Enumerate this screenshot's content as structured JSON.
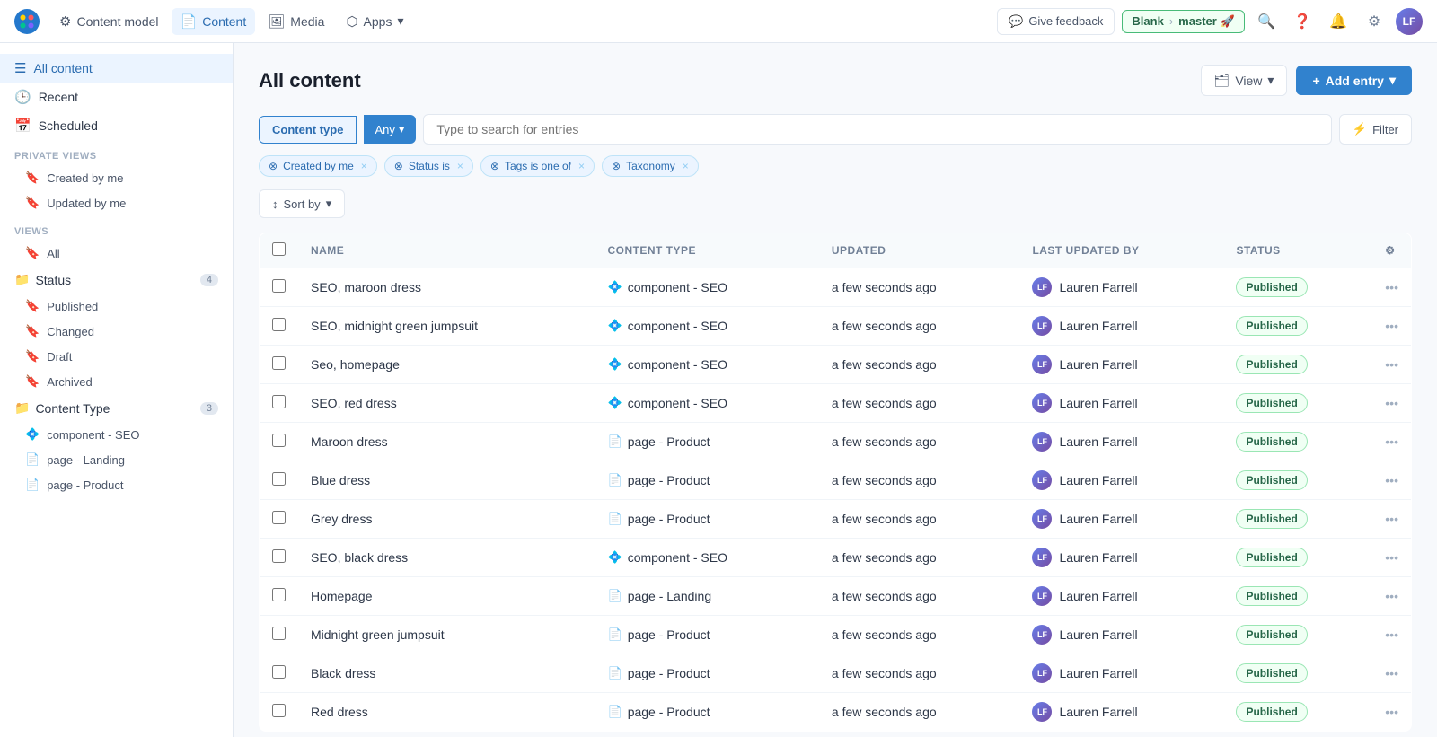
{
  "app": {
    "logo_alt": "Contentful Logo"
  },
  "topnav": {
    "items": [
      {
        "id": "content-model",
        "label": "Content model",
        "icon": "⚙",
        "active": false
      },
      {
        "id": "content",
        "label": "Content",
        "icon": "📄",
        "active": true
      },
      {
        "id": "media",
        "label": "Media",
        "icon": "🖼",
        "active": false
      },
      {
        "id": "apps",
        "label": "Apps",
        "icon": "⬡",
        "active": false,
        "has_arrow": true
      }
    ],
    "feedback": {
      "label": "Give feedback",
      "icon": "💬"
    },
    "env_badge": {
      "space": "Blank",
      "branch": "master",
      "branch_icon": "🚀"
    },
    "icon_btns": [
      "search",
      "help",
      "notifications",
      "settings"
    ],
    "avatar": {
      "initials": "LF"
    }
  },
  "sidebar": {
    "top_items": [
      {
        "id": "all-content",
        "label": "All content",
        "icon": "☰",
        "active": true
      },
      {
        "id": "recent",
        "label": "Recent",
        "icon": "🕒",
        "active": false
      },
      {
        "id": "scheduled",
        "label": "Scheduled",
        "icon": "📅",
        "active": false
      }
    ],
    "private_views_label": "Private views",
    "private_views": [
      {
        "id": "created-by-me",
        "label": "Created by me",
        "icon": "🔖"
      },
      {
        "id": "updated-by-me",
        "label": "Updated by me",
        "icon": "🔖"
      }
    ],
    "views_label": "Views",
    "views_all": {
      "id": "all",
      "label": "All",
      "icon": "🔖"
    },
    "status_group": {
      "label": "Status",
      "count": 4,
      "items": [
        {
          "id": "published",
          "label": "Published",
          "icon": "🔖"
        },
        {
          "id": "changed",
          "label": "Changed",
          "icon": "🔖"
        },
        {
          "id": "draft",
          "label": "Draft",
          "icon": "🔖"
        },
        {
          "id": "archived",
          "label": "Archived",
          "icon": "🔖"
        }
      ]
    },
    "content_type_group": {
      "label": "Content Type",
      "count": 3,
      "items": [
        {
          "id": "component-seo",
          "label": "component - SEO",
          "icon_type": "blue"
        },
        {
          "id": "page-landing",
          "label": "page - Landing",
          "icon_type": "gray"
        },
        {
          "id": "page-product",
          "label": "page - Product",
          "icon_type": "gray"
        }
      ]
    }
  },
  "main": {
    "page_title": "All content",
    "view_btn_label": "View",
    "add_entry_btn_label": "Add entry",
    "filters": {
      "content_type_btn": "Content type",
      "any_btn": "Any",
      "search_placeholder": "Type to search for entries",
      "filter_btn_label": "Filter",
      "active_tags": [
        {
          "id": "created-by-me",
          "label": "Created by me"
        },
        {
          "id": "status-is",
          "label": "Status is"
        },
        {
          "id": "tags-is-one-of",
          "label": "Tags is one of"
        },
        {
          "id": "taxonomy",
          "label": "Taxonomy"
        }
      ]
    },
    "sort": {
      "label": "Sort by"
    },
    "table": {
      "headers": [
        "Name",
        "Content Type",
        "Updated",
        "Last updated by",
        "Status"
      ],
      "rows": [
        {
          "id": 1,
          "name": "SEO, maroon dress",
          "content_type": "component - SEO",
          "ct_icon": "blue",
          "updated": "a few seconds ago",
          "updated_by": "Lauren Farrell",
          "status": "Published"
        },
        {
          "id": 2,
          "name": "SEO, midnight green jumpsuit",
          "content_type": "component - SEO",
          "ct_icon": "blue",
          "updated": "a few seconds ago",
          "updated_by": "Lauren Farrell",
          "status": "Published"
        },
        {
          "id": 3,
          "name": "Seo, homepage",
          "content_type": "component - SEO",
          "ct_icon": "blue",
          "updated": "a few seconds ago",
          "updated_by": "Lauren Farrell",
          "status": "Published"
        },
        {
          "id": 4,
          "name": "SEO, red dress",
          "content_type": "component - SEO",
          "ct_icon": "blue",
          "updated": "a few seconds ago",
          "updated_by": "Lauren Farrell",
          "status": "Published"
        },
        {
          "id": 5,
          "name": "Maroon dress",
          "content_type": "page - Product",
          "ct_icon": "gray",
          "updated": "a few seconds ago",
          "updated_by": "Lauren Farrell",
          "status": "Published"
        },
        {
          "id": 6,
          "name": "Blue dress",
          "content_type": "page - Product",
          "ct_icon": "gray",
          "updated": "a few seconds ago",
          "updated_by": "Lauren Farrell",
          "status": "Published"
        },
        {
          "id": 7,
          "name": "Grey dress",
          "content_type": "page - Product",
          "ct_icon": "gray",
          "updated": "a few seconds ago",
          "updated_by": "Lauren Farrell",
          "status": "Published"
        },
        {
          "id": 8,
          "name": "SEO, black dress",
          "content_type": "component - SEO",
          "ct_icon": "blue",
          "updated": "a few seconds ago",
          "updated_by": "Lauren Farrell",
          "status": "Published"
        },
        {
          "id": 9,
          "name": "Homepage",
          "content_type": "page - Landing",
          "ct_icon": "gray",
          "updated": "a few seconds ago",
          "updated_by": "Lauren Farrell",
          "status": "Published"
        },
        {
          "id": 10,
          "name": "Midnight green jumpsuit",
          "content_type": "page - Product",
          "ct_icon": "gray",
          "updated": "a few seconds ago",
          "updated_by": "Lauren Farrell",
          "status": "Published"
        },
        {
          "id": 11,
          "name": "Black dress",
          "content_type": "page - Product",
          "ct_icon": "gray",
          "updated": "a few seconds ago",
          "updated_by": "Lauren Farrell",
          "status": "Published"
        },
        {
          "id": 12,
          "name": "Red dress",
          "content_type": "page - Product",
          "ct_icon": "gray",
          "updated": "a few seconds ago",
          "updated_by": "Lauren Farrell",
          "status": "Published"
        }
      ]
    }
  },
  "icons": {
    "content_model": "⚙",
    "content": "📄",
    "media": "🖼",
    "apps": "⬡",
    "feedback": "💬",
    "search": "🔍",
    "help": "❓",
    "notifications": "🔔",
    "settings": "⚙",
    "view": "🗂",
    "add": "+",
    "filter": "⚡",
    "sort": "↕",
    "bookmark": "🔖",
    "clock": "🕒",
    "calendar": "📅",
    "folder": "📁",
    "chevron_down": "▾",
    "chevron_right": "›",
    "more": "•••",
    "x": "×",
    "diamond_blue": "💠",
    "page_gray": "📄",
    "settings_gear": "⚙"
  }
}
